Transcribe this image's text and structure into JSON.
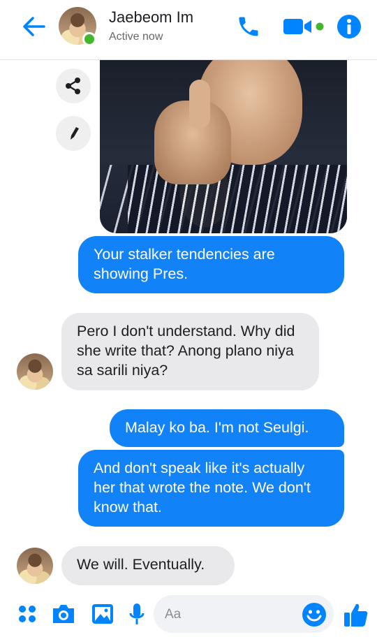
{
  "header": {
    "contact_name": "Jaebeom Im",
    "status": "Active now"
  },
  "messages": [
    {
      "direction": "outgoing",
      "text": "Your stalker tendencies are showing Pres."
    },
    {
      "direction": "incoming",
      "text": "Pero I don't understand. Why did she write that? Anong plano niya sa sarili niya?"
    },
    {
      "direction": "outgoing",
      "text": "Malay ko ba. I'm not Seulgi."
    },
    {
      "direction": "outgoing",
      "text": "And don't speak like it's actually her that wrote the note. We don't know that."
    },
    {
      "direction": "incoming",
      "text": "We will. Eventually."
    }
  ],
  "composer": {
    "placeholder": "Aa"
  },
  "colors": {
    "accent": "#0084ff",
    "outgoing_bubble": "#1182f7",
    "incoming_bubble": "#e9e9eb",
    "online": "#42b72a"
  },
  "icons": {
    "header": [
      "back-arrow-icon",
      "phone-icon",
      "video-camera-icon",
      "info-icon"
    ],
    "side": [
      "share-icon",
      "pencil-icon"
    ],
    "composer": [
      "more-options-icon",
      "camera-icon",
      "gallery-icon",
      "microphone-icon",
      "emoji-icon",
      "thumbs-up-icon"
    ]
  }
}
